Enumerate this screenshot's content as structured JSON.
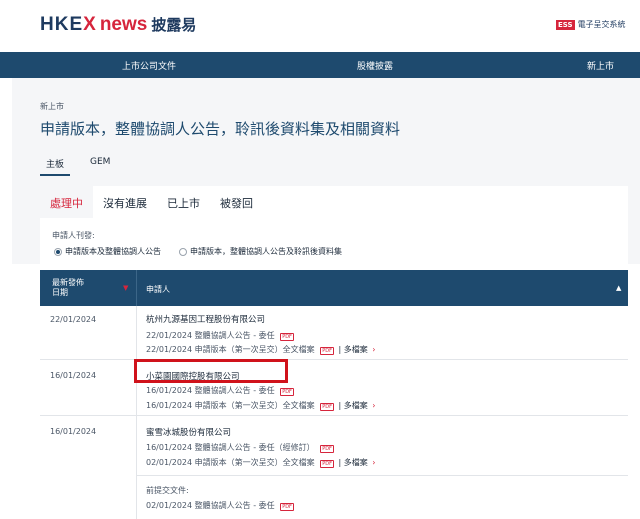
{
  "header": {
    "logo_hkex": "HKE",
    "logo_x": "X",
    "logo_news": "news",
    "logo_cn": "披露易",
    "ess_badge": "ESS",
    "ess_label": "電子呈交系統"
  },
  "nav": {
    "items": [
      "上市公司文件",
      "股權披露",
      "新上市"
    ]
  },
  "breadcrumb": "新上市",
  "page_title": "申請版本，整體協調人公告，聆訊後資料集及相關資料",
  "board_tabs": [
    "主板",
    "GEM"
  ],
  "status_tabs": [
    "處理中",
    "沒有進展",
    "已上市",
    "被發回"
  ],
  "filter": {
    "label": "申請人刊發:",
    "options": [
      "申請版本及整體協調人公告",
      "申請版本，整體協調人公告及聆訊後資料集"
    ]
  },
  "table": {
    "col_date": "最新發佈",
    "col_date2": "日期",
    "col_applicant": "申請人",
    "rows": [
      {
        "date": "22/01/2024",
        "company": "杭州九源基因工程股份有限公司",
        "docs": [
          {
            "date": "22/01/2024",
            "title": "整體協調人公告 - 委任",
            "pdf": "PDF",
            "more": ""
          },
          {
            "date": "22/01/2024",
            "title": "申請版本（第一次呈交）全文檔案",
            "pdf": "PDF",
            "more": "| 多檔案"
          }
        ]
      },
      {
        "date": "16/01/2024",
        "company": "小菜園國際控股有限公司",
        "docs": [
          {
            "date": "16/01/2024",
            "title": "整體協調人公告 - 委任",
            "pdf": "PDF",
            "more": ""
          },
          {
            "date": "16/01/2024",
            "title": "申請版本（第一次呈交）全文檔案",
            "pdf": "PDF",
            "more": "| 多檔案"
          }
        ]
      },
      {
        "date": "16/01/2024",
        "company": "蜜雪冰城股份有限公司",
        "docs": [
          {
            "date": "16/01/2024",
            "title": "整體協調人公告 - 委任（經修訂）",
            "pdf": "PDF",
            "more": ""
          },
          {
            "date": "02/01/2024",
            "title": "申請版本（第一次呈交）全文檔案",
            "pdf": "PDF",
            "more": "| 多檔案"
          }
        ],
        "prev_label": "前提交文件:",
        "prev_docs": [
          {
            "date": "02/01/2024",
            "title": "整體協調人公告 - 委任",
            "pdf": "PDF",
            "more": ""
          }
        ]
      }
    ]
  },
  "colors": {
    "brand_navy": "#1e4a6e",
    "accent_red": "#d6253c",
    "highlight_red": "#d0121b"
  }
}
